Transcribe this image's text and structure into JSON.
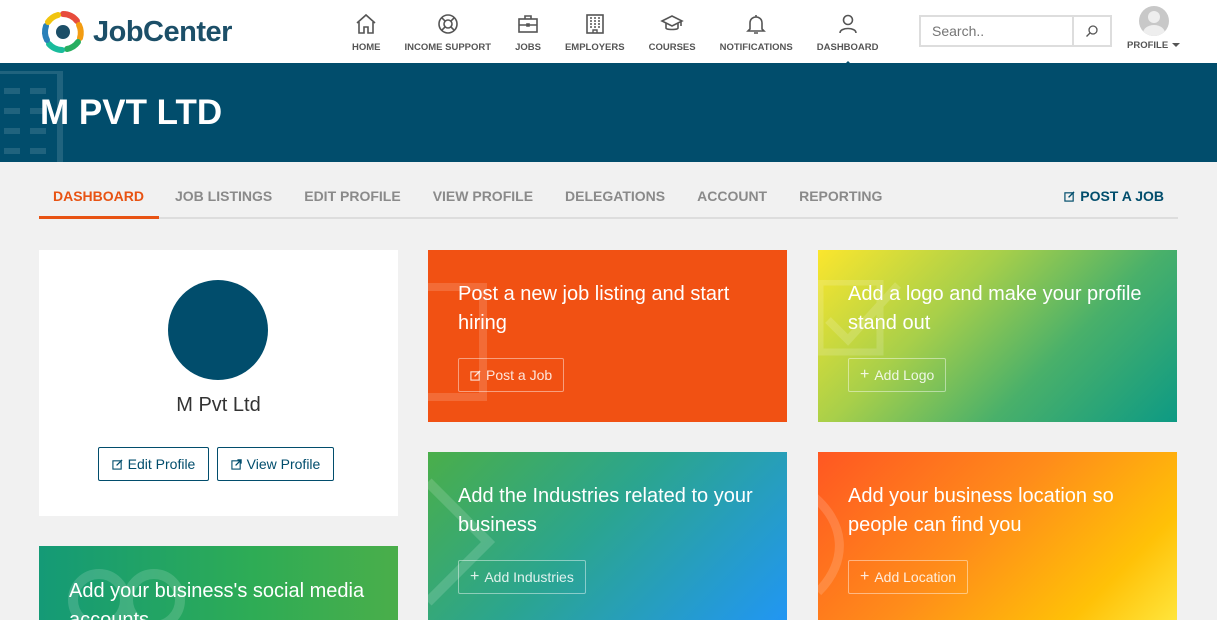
{
  "brand": {
    "name": "JobCenter"
  },
  "nav": {
    "items": [
      {
        "label": "HOME",
        "icon": "home-icon"
      },
      {
        "label": "INCOME SUPPORT",
        "icon": "lifebuoy-icon"
      },
      {
        "label": "JOBS",
        "icon": "briefcase-icon"
      },
      {
        "label": "EMPLOYERS",
        "icon": "building-icon"
      },
      {
        "label": "COURSES",
        "icon": "graduation-cap-icon"
      },
      {
        "label": "NOTIFICATIONS",
        "icon": "bell-icon"
      },
      {
        "label": "DASHBOARD",
        "icon": "user-icon",
        "active": true
      }
    ]
  },
  "search": {
    "placeholder": "Search.."
  },
  "profile_menu": {
    "label": "PROFILE"
  },
  "hero": {
    "title": "M PVT LTD"
  },
  "tabs": {
    "items": [
      "DASHBOARD",
      "JOB LISTINGS",
      "EDIT PROFILE",
      "VIEW PROFILE",
      "DELEGATIONS",
      "ACCOUNT",
      "REPORTING"
    ],
    "active": "DASHBOARD",
    "post_job": "POST A JOB"
  },
  "profile_card": {
    "name": "M Pvt Ltd",
    "edit_label": "Edit Profile",
    "view_label": "View Profile"
  },
  "tiles": {
    "post_job": {
      "text": "Post a new job listing and start hiring",
      "button": "Post a Job"
    },
    "logo": {
      "text": "Add a logo and make your profile stand out",
      "button": "Add Logo"
    },
    "industries": {
      "text": "Add the Industries related to your business",
      "button": "Add Industries"
    },
    "location": {
      "text": "Add your business location so people can find you",
      "button": "Add Location"
    },
    "social": {
      "text": "Add your business's social media accounts"
    }
  },
  "colors": {
    "brand": "#014d6c",
    "accent": "#e85313",
    "post_tile": "#f15113"
  }
}
